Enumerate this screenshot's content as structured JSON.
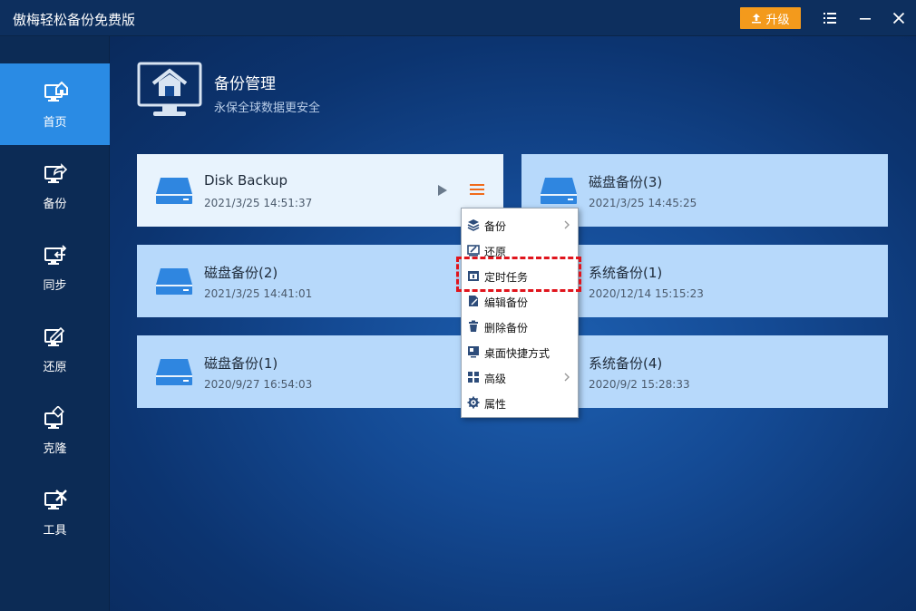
{
  "app": {
    "title": "傲梅轻松备份免费版",
    "upgrade_label": "升级",
    "accent": "#2a8be4",
    "upgrade_color": "#f39a1c"
  },
  "sidebar": {
    "items": [
      {
        "label": "首页",
        "icon": "home-monitor-icon"
      },
      {
        "label": "备份",
        "icon": "backup-monitor-icon"
      },
      {
        "label": "同步",
        "icon": "sync-monitor-icon"
      },
      {
        "label": "还原",
        "icon": "restore-monitor-icon"
      },
      {
        "label": "克隆",
        "icon": "clone-monitor-icon"
      },
      {
        "label": "工具",
        "icon": "tools-monitor-icon"
      }
    ]
  },
  "header": {
    "title": "备份管理",
    "subtitle": "永保全球数据更安全"
  },
  "tasks": [
    {
      "name": "Disk Backup",
      "time": "2021/3/25 14:51:37"
    },
    {
      "name": "磁盘备份(3)",
      "time": "2021/3/25 14:45:25"
    },
    {
      "name": "磁盘备份(2)",
      "time": "2021/3/25 14:41:01"
    },
    {
      "name": "系统备份(1)",
      "time": "2020/12/14 15:15:23"
    },
    {
      "name": "磁盘备份(1)",
      "time": "2020/9/27 16:54:03"
    },
    {
      "name": "系统备份(4)",
      "time": "2020/9/2 15:28:33"
    }
  ],
  "context_menu": {
    "items": [
      {
        "label": "备份",
        "icon": "layers-icon"
      },
      {
        "label": "还原",
        "icon": "restore-icon"
      },
      {
        "label": "定时任务",
        "icon": "calendar-icon"
      },
      {
        "label": "编辑备份",
        "icon": "edit-icon"
      },
      {
        "label": "删除备份",
        "icon": "trash-icon"
      },
      {
        "label": "桌面快捷方式",
        "icon": "shortcut-icon"
      },
      {
        "label": "高级",
        "icon": "grid-icon"
      },
      {
        "label": "属性",
        "icon": "gear-icon"
      }
    ]
  }
}
